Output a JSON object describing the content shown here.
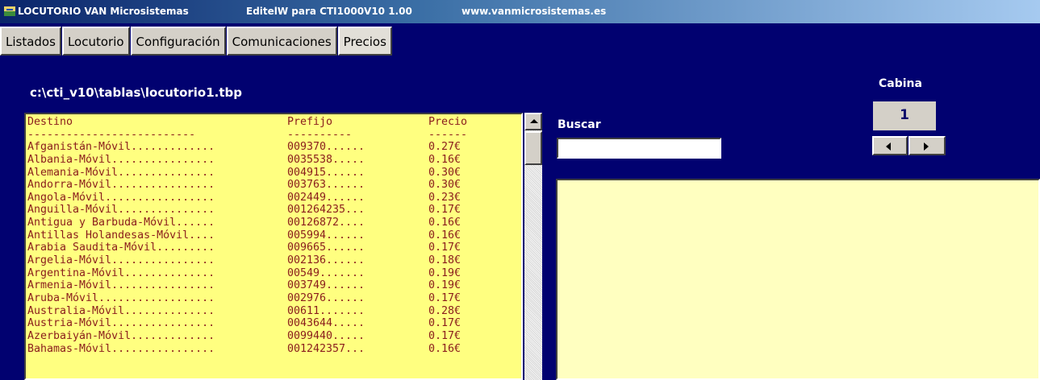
{
  "titlebar": {
    "app_name": "LOCUTORIO VAN Microsistemas",
    "editor": "EditelW para CTI1000V10 1.00",
    "website": "www.vanmicrosistemas.es"
  },
  "tabs": [
    {
      "label": "Listados"
    },
    {
      "label": "Locutorio"
    },
    {
      "label": "Configuración"
    },
    {
      "label": "Comunicaciones"
    },
    {
      "label": "Precios",
      "active": true
    }
  ],
  "file_path": "c:\\cti_v10\\tablas\\locutorio1.tbp",
  "list": {
    "header": [
      "Destino",
      "Prefijo",
      "Precio"
    ],
    "separator": [
      "--------------------------",
      "----------",
      "------"
    ],
    "rows": [
      [
        "Afganistán-Móvil.............",
        "009370......",
        "0.27€"
      ],
      [
        "Albania-Móvil................",
        "0035538.....",
        "0.16€"
      ],
      [
        "Alemania-Móvil...............",
        "004915......",
        "0.30€"
      ],
      [
        "Andorra-Móvil................",
        "003763......",
        "0.30€"
      ],
      [
        "Angola-Móvil.................",
        "002449......",
        "0.23€"
      ],
      [
        "Anguilla-Móvil...............",
        "001264235...",
        "0.17€"
      ],
      [
        "Antigua y Barbuda-Móvil......",
        "00126872....",
        "0.16€"
      ],
      [
        "Antillas Holandesas-Móvil....",
        "005994......",
        "0.16€"
      ],
      [
        "Arabia Saudita-Móvil.........",
        "009665......",
        "0.17€"
      ],
      [
        "Argelia-Móvil................",
        "002136......",
        "0.18€"
      ],
      [
        "Argentina-Móvil..............",
        "00549.......",
        "0.19€"
      ],
      [
        "Armenia-Móvil................",
        "003749......",
        "0.19€"
      ],
      [
        "Aruba-Móvil..................",
        "002976......",
        "0.17€"
      ],
      [
        "Australia-Móvil..............",
        "00611.......",
        "0.28€"
      ],
      [
        "Austria-Móvil................",
        "0043644.....",
        "0.17€"
      ],
      [
        "Azerbaiyán-Móvil.............",
        "0099440.....",
        "0.17€"
      ],
      [
        "Bahamas-Móvil................",
        "001242357...",
        "0.16€"
      ]
    ]
  },
  "search": {
    "label": "Buscar",
    "value": ""
  },
  "cabina": {
    "label": "Cabina",
    "value": "1"
  },
  "icons": {
    "app": "app-icon",
    "scroll_up": "scroll-up-icon",
    "prev": "arrow-left-icon",
    "next": "arrow-right-icon"
  }
}
